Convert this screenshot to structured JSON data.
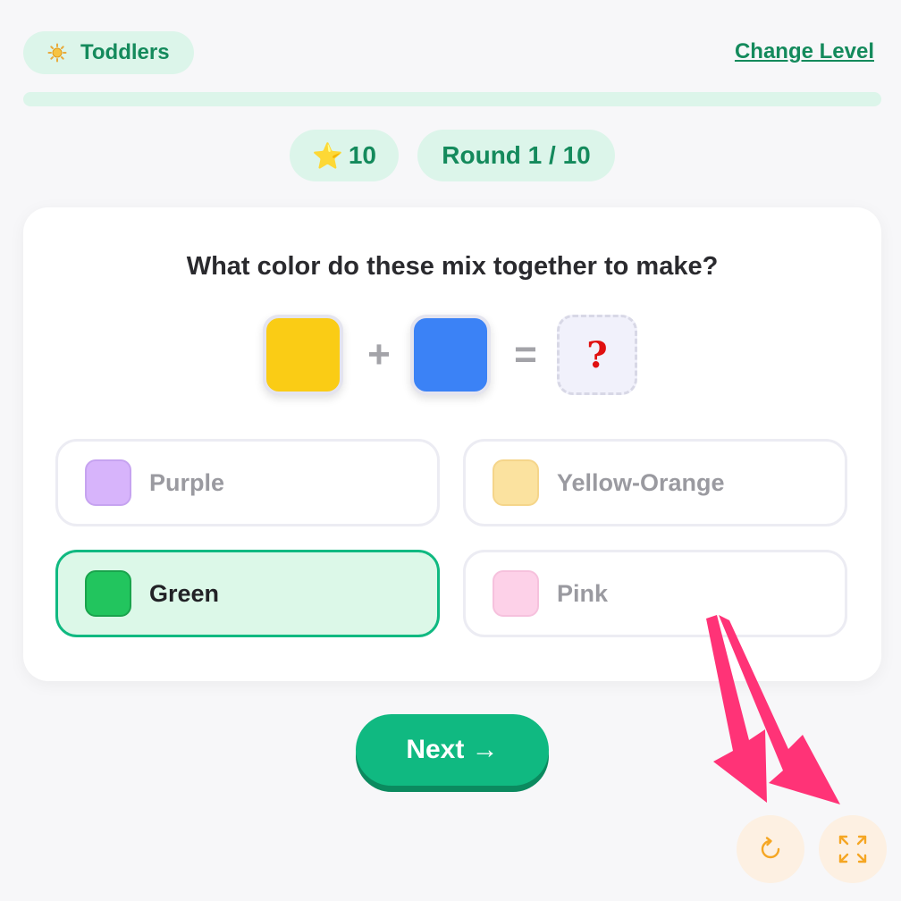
{
  "header": {
    "level_label": "Toddlers",
    "level_icon": "sun-icon",
    "change_level_label": "Change Level",
    "progress": 0
  },
  "stats": {
    "score": "10",
    "score_icon": "star-icon",
    "round_label": "Round 1 / 10"
  },
  "question": {
    "text": "What color do these mix together to make?",
    "color_a": "#facc15",
    "color_b": "#3b82f6",
    "plus": "+",
    "equals": "=",
    "unknown": "?"
  },
  "options": [
    {
      "label": "Purple",
      "color": "#d7b4fb",
      "border": "#c6a3f0",
      "selected": false
    },
    {
      "label": "Yellow-Orange",
      "color": "#fbe29f",
      "border": "#f5d58a",
      "selected": false
    },
    {
      "label": "Green",
      "color": "#22c55e",
      "border": "#1aa34c",
      "selected": true
    },
    {
      "label": "Pink",
      "color": "#fdd1e8",
      "border": "#f6c1dd",
      "selected": false
    }
  ],
  "actions": {
    "next_label": "Next →",
    "restart_icon": "restart-icon",
    "fullscreen_icon": "fullscreen-icon"
  },
  "colors": {
    "accent": "#10b981",
    "accent_dark": "#148a5c",
    "pill_bg": "#dcf5ea",
    "annotation_arrow": "#ff3377",
    "control_bg": "#fdf0e2",
    "control_icon": "#f5a623"
  }
}
